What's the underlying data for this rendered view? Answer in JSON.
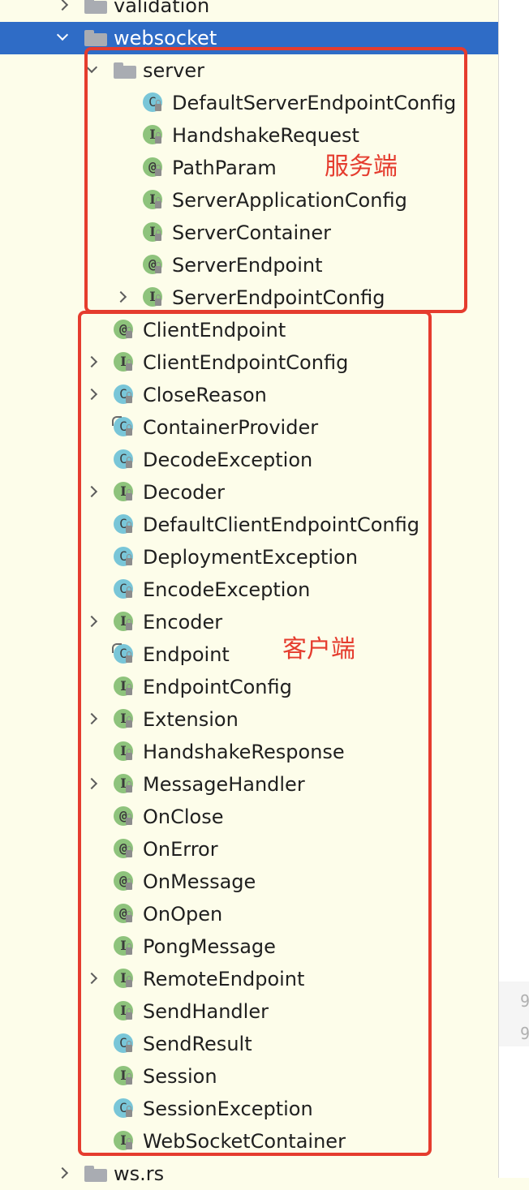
{
  "tree": {
    "rows": [
      {
        "label": "validation",
        "kind": "folder",
        "level": 0,
        "chevron": "right"
      },
      {
        "label": "websocket",
        "kind": "folder",
        "level": 0,
        "chevron": "down",
        "selected": true
      },
      {
        "label": "server",
        "kind": "folder",
        "level": 1,
        "chevron": "down"
      },
      {
        "label": "DefaultServerEndpointConfig",
        "kind": "c",
        "level": 2,
        "chevron": ""
      },
      {
        "label": "HandshakeRequest",
        "kind": "i",
        "level": 2,
        "chevron": ""
      },
      {
        "label": "PathParam",
        "kind": "a",
        "level": 2,
        "chevron": ""
      },
      {
        "label": "ServerApplicationConfig",
        "kind": "i",
        "level": 2,
        "chevron": ""
      },
      {
        "label": "ServerContainer",
        "kind": "i",
        "level": 2,
        "chevron": ""
      },
      {
        "label": "ServerEndpoint",
        "kind": "a",
        "level": 2,
        "chevron": ""
      },
      {
        "label": "ServerEndpointConfig",
        "kind": "i",
        "level": 2,
        "chevron": "right"
      },
      {
        "label": "ClientEndpoint",
        "kind": "a",
        "level": 1,
        "chevron": ""
      },
      {
        "label": "ClientEndpointConfig",
        "kind": "i",
        "level": 1,
        "chevron": "right"
      },
      {
        "label": "CloseReason",
        "kind": "c",
        "level": 1,
        "chevron": "right"
      },
      {
        "label": "ContainerProvider",
        "kind": "c-abs",
        "level": 1,
        "chevron": ""
      },
      {
        "label": "DecodeException",
        "kind": "c",
        "level": 1,
        "chevron": ""
      },
      {
        "label": "Decoder",
        "kind": "i",
        "level": 1,
        "chevron": "right"
      },
      {
        "label": "DefaultClientEndpointConfig",
        "kind": "c",
        "level": 1,
        "chevron": ""
      },
      {
        "label": "DeploymentException",
        "kind": "c",
        "level": 1,
        "chevron": ""
      },
      {
        "label": "EncodeException",
        "kind": "c",
        "level": 1,
        "chevron": ""
      },
      {
        "label": "Encoder",
        "kind": "i",
        "level": 1,
        "chevron": "right"
      },
      {
        "label": "Endpoint",
        "kind": "c-abs",
        "level": 1,
        "chevron": ""
      },
      {
        "label": "EndpointConfig",
        "kind": "i",
        "level": 1,
        "chevron": ""
      },
      {
        "label": "Extension",
        "kind": "i",
        "level": 1,
        "chevron": "right"
      },
      {
        "label": "HandshakeResponse",
        "kind": "i",
        "level": 1,
        "chevron": ""
      },
      {
        "label": "MessageHandler",
        "kind": "i",
        "level": 1,
        "chevron": "right"
      },
      {
        "label": "OnClose",
        "kind": "a",
        "level": 1,
        "chevron": ""
      },
      {
        "label": "OnError",
        "kind": "a",
        "level": 1,
        "chevron": ""
      },
      {
        "label": "OnMessage",
        "kind": "a",
        "level": 1,
        "chevron": ""
      },
      {
        "label": "OnOpen",
        "kind": "a",
        "level": 1,
        "chevron": ""
      },
      {
        "label": "PongMessage",
        "kind": "i",
        "level": 1,
        "chevron": ""
      },
      {
        "label": "RemoteEndpoint",
        "kind": "i",
        "level": 1,
        "chevron": "right"
      },
      {
        "label": "SendHandler",
        "kind": "i",
        "level": 1,
        "chevron": ""
      },
      {
        "label": "SendResult",
        "kind": "c",
        "level": 1,
        "chevron": ""
      },
      {
        "label": "Session",
        "kind": "i",
        "level": 1,
        "chevron": ""
      },
      {
        "label": "SessionException",
        "kind": "c",
        "level": 1,
        "chevron": ""
      },
      {
        "label": "WebSocketContainer",
        "kind": "i",
        "level": 1,
        "chevron": ""
      },
      {
        "label": "ws.rs",
        "kind": "folder",
        "level": 0,
        "chevron": "right"
      }
    ]
  },
  "icon_letters": {
    "c": "C",
    "i": "I",
    "a": "@"
  },
  "annotations": {
    "server_label": "服务端",
    "client_label": "客户端",
    "color": "#e53c2e"
  },
  "right_panel": {
    "line_numbers": [
      "9",
      "9"
    ]
  },
  "colors": {
    "background": "#fdfdea",
    "selection": "#2f6cc6",
    "class_icon": "#79c6d8",
    "interface_icon": "#8ec37c"
  }
}
